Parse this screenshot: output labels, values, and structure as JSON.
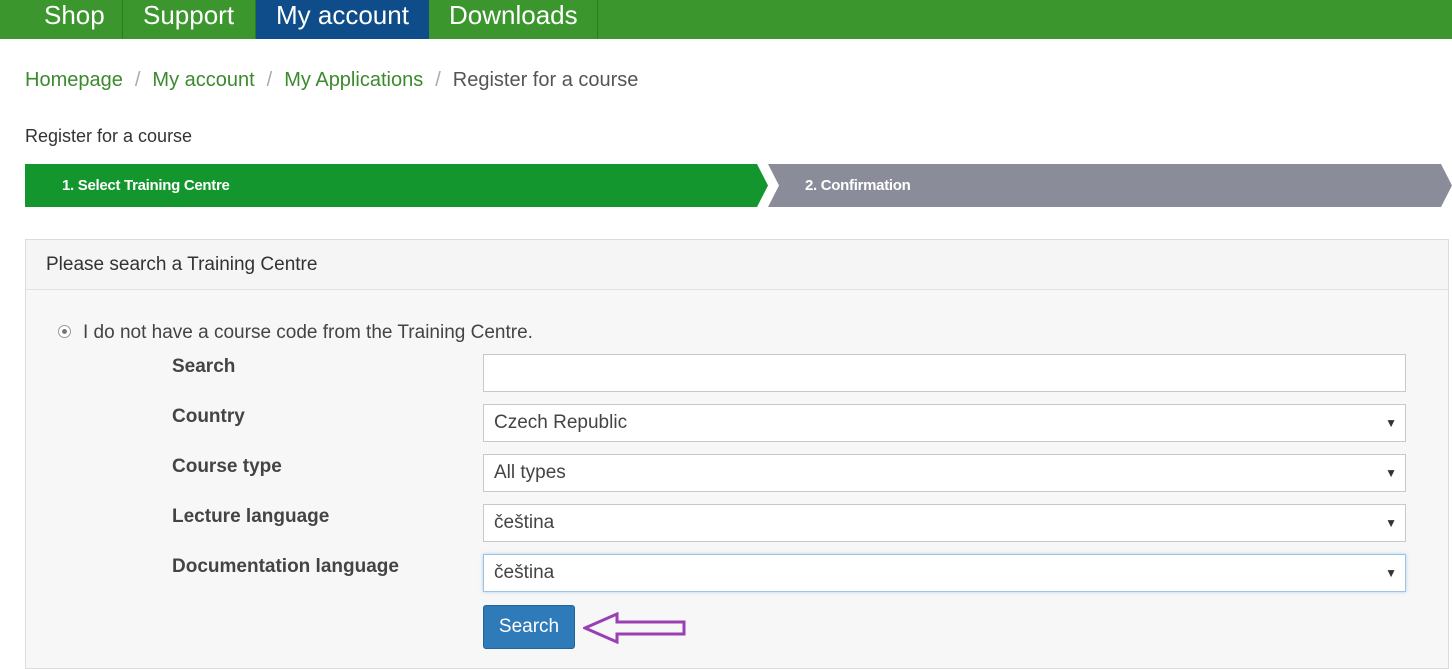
{
  "nav": {
    "items": [
      {
        "label": "Shop"
      },
      {
        "label": "Support"
      },
      {
        "label": "My account",
        "active": true
      },
      {
        "label": "Downloads"
      }
    ]
  },
  "breadcrumb": {
    "items": [
      "Homepage",
      "My account",
      "My Applications"
    ],
    "current": "Register for a course",
    "separator": "/"
  },
  "page": {
    "title": "Register for a course"
  },
  "wizard": {
    "steps": [
      {
        "label": "1. Select Training Centre",
        "active": true,
        "color": "#14962e"
      },
      {
        "label": "2. Confirmation",
        "active": false,
        "color": "#8a8d99"
      }
    ]
  },
  "panel": {
    "title": "Please search a Training Centre",
    "option_label": "I do not have a course code from the Training Centre.",
    "fields": {
      "search": {
        "label": "Search",
        "value": ""
      },
      "country": {
        "label": "Country",
        "value": "Czech Republic"
      },
      "course_type": {
        "label": "Course type",
        "value": "All types"
      },
      "lecture_language": {
        "label": "Lecture language",
        "value": "čeština"
      },
      "documentation_language": {
        "label": "Documentation language",
        "value": "čeština"
      }
    },
    "search_button": "Search"
  },
  "colors": {
    "nav_green": "#3c962e",
    "nav_active": "#0f4d8a",
    "link_green": "#3c8a2e",
    "button_blue": "#2f7ab9",
    "annotation_arrow": "#9b3fb5"
  }
}
